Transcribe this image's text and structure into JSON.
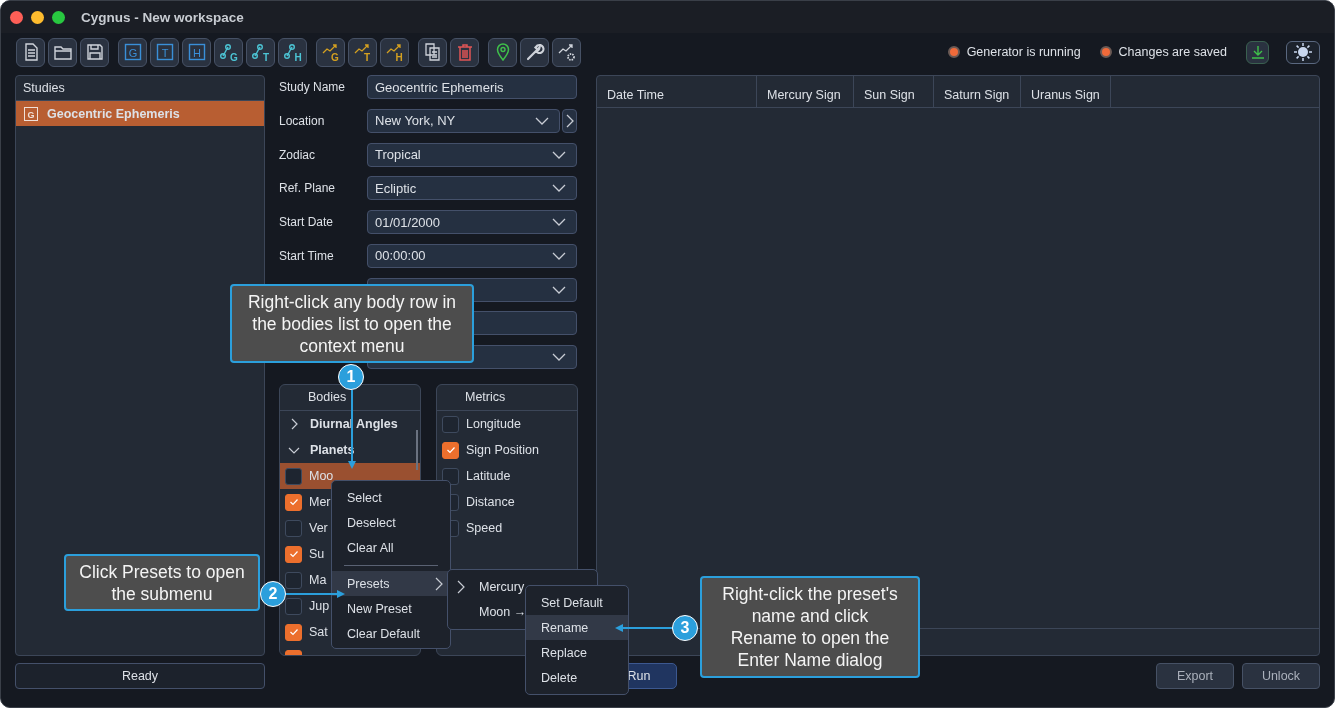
{
  "window": {
    "title": "Cygnus - New workspace"
  },
  "toolbar": [
    [
      {
        "kind": "document"
      },
      {
        "kind": "folder"
      },
      {
        "kind": "save"
      }
    ],
    [
      {
        "kind": "boxed",
        "letter": "G"
      },
      {
        "kind": "boxed",
        "letter": "T"
      },
      {
        "kind": "boxed",
        "letter": "H"
      },
      {
        "kind": "nodes",
        "letter": "G"
      },
      {
        "kind": "nodes",
        "letter": "T"
      },
      {
        "kind": "nodes",
        "letter": "H"
      }
    ],
    [
      {
        "kind": "trend",
        "letter": "G"
      },
      {
        "kind": "trend",
        "letter": "T"
      },
      {
        "kind": "trend",
        "letter": "H"
      }
    ],
    [
      {
        "kind": "copy"
      },
      {
        "kind": "trash"
      }
    ],
    [
      {
        "kind": "pin"
      },
      {
        "kind": "wrench"
      },
      {
        "kind": "trend-gear"
      }
    ]
  ],
  "indicators": [
    {
      "label": "Generator is running",
      "on": true
    },
    {
      "label": "Changes are saved",
      "on": true
    }
  ],
  "studies": {
    "title": "Studies",
    "items": [
      {
        "letter": "G",
        "label": "Geocentric Ephemeris",
        "selected": true
      }
    ]
  },
  "form": [
    {
      "label": "Study Name",
      "kind": "text",
      "value": "Geocentric Ephemeris"
    },
    {
      "label": "Location",
      "kind": "select-more",
      "value": "New York, NY"
    },
    {
      "label": "Zodiac",
      "kind": "select",
      "value": "Tropical"
    },
    {
      "label": "Ref. Plane",
      "kind": "select",
      "value": "Ecliptic"
    },
    {
      "label": "Start Date",
      "kind": "select",
      "value": "01/01/2000"
    },
    {
      "label": "Start Time",
      "kind": "select",
      "value": "00:00:00"
    },
    {
      "kind": "select"
    },
    {
      "kind": "text"
    },
    {
      "kind": "select"
    }
  ],
  "bodies": {
    "title": "Bodies",
    "groups": [
      {
        "label": "Diurnal Angles",
        "expanded": false
      },
      {
        "label": "Planets",
        "expanded": true,
        "children": [
          {
            "label": "Moo",
            "checked": false,
            "selected": true
          },
          {
            "label": "Mer",
            "checked": true,
            "selected": false
          },
          {
            "label": "Ver",
            "checked": false,
            "selected": false
          },
          {
            "label": "Su",
            "checked": true,
            "selected": false
          },
          {
            "label": "Ma",
            "checked": false,
            "selected": false
          },
          {
            "label": "Jup",
            "checked": false,
            "selected": false
          },
          {
            "label": "Sat",
            "checked": true,
            "selected": false
          },
          {
            "checked": true,
            "selected": false
          }
        ]
      }
    ]
  },
  "metrics": {
    "title": "Metrics",
    "items": [
      {
        "label": "Longitude",
        "checked": false
      },
      {
        "label": "Sign Position",
        "checked": true
      },
      {
        "label": "Latitude",
        "checked": false
      },
      {
        "label": "Distance",
        "checked": false
      },
      {
        "label": "Speed",
        "checked": false
      }
    ]
  },
  "table": {
    "columns": [
      "Date Time",
      "Mercury Sign",
      "Sun Sign",
      "Saturn Sign",
      "Uranus Sign"
    ]
  },
  "status": "Ready",
  "buttons": {
    "run": "Run",
    "export": "Export",
    "unlock": "Unlock"
  },
  "context_menu": [
    {
      "kind": "item",
      "label": "Select",
      "highlighted": false
    },
    {
      "kind": "item",
      "label": "Deselect",
      "highlighted": false
    },
    {
      "kind": "item",
      "label": "Clear All",
      "highlighted": false
    },
    {
      "kind": "separator"
    },
    {
      "kind": "submenu",
      "label": "Presets",
      "highlighted": true
    },
    {
      "kind": "item",
      "label": "New Preset",
      "highlighted": false
    },
    {
      "kind": "item",
      "label": "Clear Default",
      "highlighted": false
    }
  ],
  "presets_menu": [
    {
      "kind": "group",
      "label": "Mercury"
    },
    {
      "kind": "item",
      "label": "Moon →"
    }
  ],
  "preset_actions": [
    {
      "label": "Set Default",
      "highlighted": false
    },
    {
      "label": "Rename",
      "highlighted": true
    },
    {
      "label": "Replace",
      "highlighted": false
    },
    {
      "label": "Delete",
      "highlighted": false
    }
  ],
  "callouts": [
    {
      "number": "1",
      "text": "Right-click any body row in the bodies list to open the context menu"
    },
    {
      "number": "2",
      "text": "Click Presets to open the submenu"
    },
    {
      "number": "3",
      "text": "Right-click the preset's name and click Rename to open the Enter Name dialog"
    }
  ]
}
